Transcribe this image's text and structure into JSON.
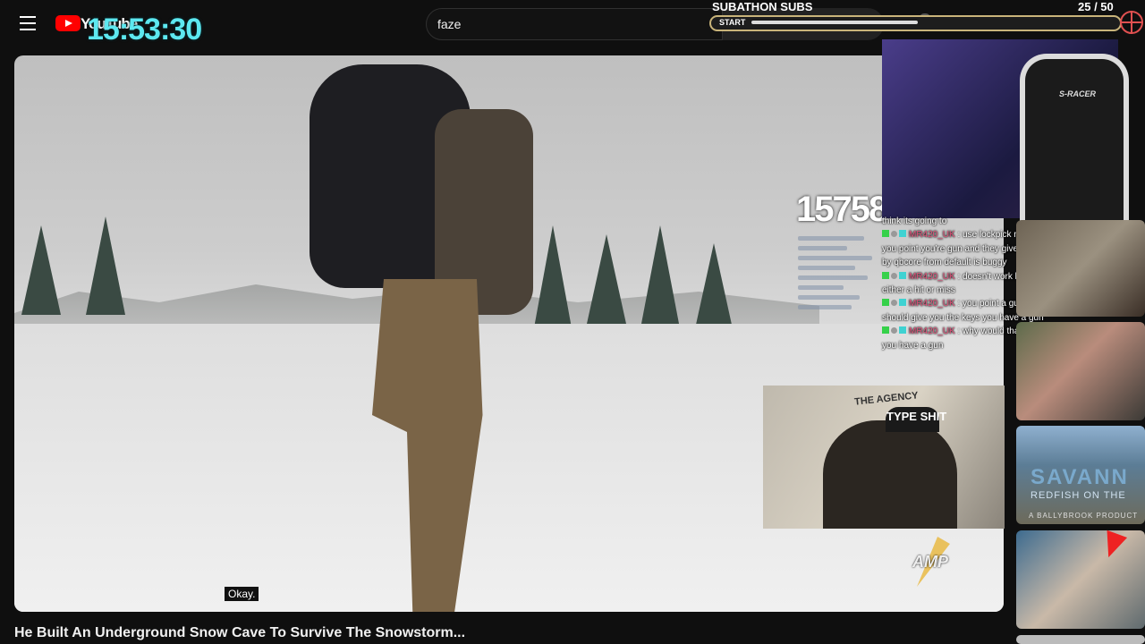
{
  "overlay_clock": "15:53:30",
  "header": {
    "logo_text": "YouTube",
    "search_value": "faze"
  },
  "subathon": {
    "title": "SUBATHON SUBS",
    "count": "25  / 50",
    "start_label": "START",
    "progress_fraction": 0.5
  },
  "score": "15758",
  "chat": {
    "first_line": "think its going to",
    "messages": [
      {
        "user": "MR420_UK",
        "text": ": use lockpick minigame pops up or you point you're gun and they give you the keys the one by qbcore from default is buggy"
      },
      {
        "user": "MR420_UK",
        "text": ": doesn't work half of the time its either a hit or miss"
      },
      {
        "user": "MR420_UK",
        "text": ": you point a gun at someone they should give you the keys you have a gun"
      },
      {
        "user": "MR420_UK",
        "text": ": why would that be a chance thing if you have a gun"
      }
    ]
  },
  "webcam": {
    "chair_label": "S-RACER",
    "agency_text": "THE AGENCY",
    "cap_text": "TYPE SHIT"
  },
  "amp_logo": "AMP",
  "caption": "Okay.",
  "thumbnails": {
    "thumb3_title": "SAVANN",
    "thumb3_sub": "REDFISH ON THE",
    "thumb3_sub2": "A BALLYBROOK PRODUCT"
  },
  "video_title": "He Built An Underground Snow Cave To Survive The Snowstorm..."
}
